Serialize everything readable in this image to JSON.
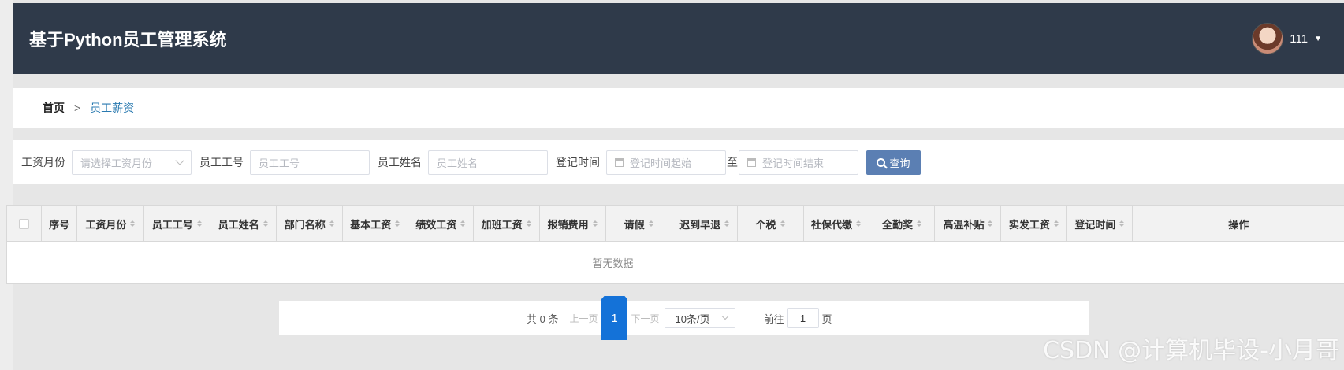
{
  "header": {
    "title": "基于Python员工管理系统",
    "username": "111"
  },
  "breadcrumb": {
    "home": "首页",
    "separator": ">",
    "current": "员工薪资"
  },
  "filters": {
    "salary_month_label": "工资月份",
    "salary_month_placeholder": "请选择工资月份",
    "emp_no_label": "员工工号",
    "emp_no_placeholder": "员工工号",
    "emp_name_label": "员工姓名",
    "emp_name_placeholder": "员工姓名",
    "register_time_label": "登记时间",
    "start_placeholder": "登记时间起始",
    "to": "至",
    "end_placeholder": "登记时间结束",
    "search_label": "查询"
  },
  "table": {
    "columns": [
      "序号",
      "工资月份",
      "员工工号",
      "员工姓名",
      "部门名称",
      "基本工资",
      "绩效工资",
      "加班工资",
      "报销费用",
      "请假",
      "迟到早退",
      "个税",
      "社保代缴",
      "全勤奖",
      "高温补贴",
      "实发工资",
      "登记时间",
      "操作"
    ],
    "empty_text": "暂无数据"
  },
  "pagination": {
    "total": "共 0 条",
    "prev": "上一页",
    "current_page": "1",
    "next": "下一页",
    "page_size": "10条/页",
    "goto_label": "前往",
    "goto_value": "1",
    "page_unit": "页"
  },
  "watermark": "CSDN @计算机毕设-小月哥",
  "colors": {
    "header_bg": "#2f3a4a",
    "accent": "#1472d8",
    "search_button": "#5b7fb3"
  }
}
